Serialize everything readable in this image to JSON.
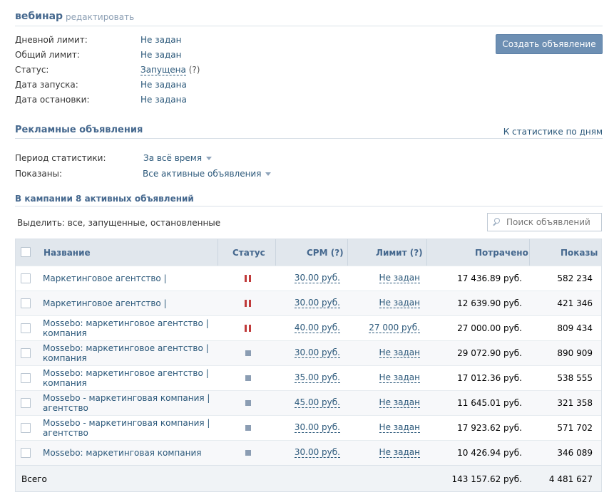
{
  "campaign": {
    "title": "вебинар",
    "edit_label": "редактировать",
    "create_button": "Создать объявление"
  },
  "info": [
    {
      "label": "Дневной лимит:",
      "value": "Не задан"
    },
    {
      "label": "Общий лимит:",
      "value": "Не задан"
    },
    {
      "label": "Статус:",
      "value": "Запущена",
      "help": "(?)"
    },
    {
      "label": "Дата запуска:",
      "value": "Не задана"
    },
    {
      "label": "Дата остановки:",
      "value": "Не задана"
    }
  ],
  "ads_section": {
    "title": "Рекламные объявления",
    "stats_link": "К статистике по дням",
    "period_label": "Период статистики:",
    "period_value": "За всё время",
    "shown_label": "Показаны:",
    "shown_value": "Все активные объявления",
    "count_title": "В кампании 8 активных объявлений",
    "select_line": "Выделить: все, запущенные, остановленные",
    "search_placeholder": "Поиск объявлений"
  },
  "table": {
    "headers": {
      "name": "Название",
      "status": "Статус",
      "cpm": "CPM (?)",
      "limit": "Лимит (?)",
      "spent": "Потрачено",
      "views": "Показы"
    },
    "rows": [
      {
        "name": "Маркетинговое агентство |",
        "status": "paused",
        "cpm": "30.00 руб.",
        "limit": "Не задан",
        "spent": "17 436.89 руб.",
        "views": "582 234"
      },
      {
        "name": "Маркетинговое агентство |",
        "status": "paused",
        "cpm": "30.00 руб.",
        "limit": "Не задан",
        "spent": "12 639.90 руб.",
        "views": "421 346"
      },
      {
        "name": "Mossebo: маркетинговое агентство |",
        "name2": "компания",
        "status": "paused",
        "cpm": "40.00 руб.",
        "limit": "27 000 руб.",
        "spent": "27 000.00 руб.",
        "views": "809 434"
      },
      {
        "name": "Mossebo: маркетинговое агентство |",
        "name2": "компания",
        "status": "stopped",
        "cpm": "30.00 руб.",
        "limit": "Не задан",
        "spent": "29 072.90 руб.",
        "views": "890 909"
      },
      {
        "name": "Mossebo: маркетинговое агентство |",
        "name2": "компания",
        "status": "stopped",
        "cpm": "35.00 руб.",
        "limit": "Не задан",
        "spent": "17 012.36 руб.",
        "views": "538 555"
      },
      {
        "name": "Mossebo - маркетинговая компания |",
        "name2": "агентство",
        "status": "stopped",
        "cpm": "45.00 руб.",
        "limit": "Не задан",
        "spent": "11 645.01 руб.",
        "views": "321 358"
      },
      {
        "name": "Mossebo - маркетинговая компания |",
        "name2": "агентство",
        "status": "stopped",
        "cpm": "30.00 руб.",
        "limit": "Не задан",
        "spent": "17 923.62 руб.",
        "views": "571 702"
      },
      {
        "name": "Mossebo: маркетинговая компания",
        "status": "stopped",
        "cpm": "30.00 руб.",
        "limit": "Не задан",
        "spent": "10 426.94 руб.",
        "views": "346 089"
      }
    ],
    "total": {
      "label": "Всего",
      "spent": "143 157.62 руб.",
      "views": "4 481 627"
    }
  },
  "colors": {
    "accent": "#45688e",
    "link": "#2b587a",
    "button": "#6d8fb3",
    "paused_icon": "#c03a3a",
    "stopped_icon": "#8b9db3"
  }
}
